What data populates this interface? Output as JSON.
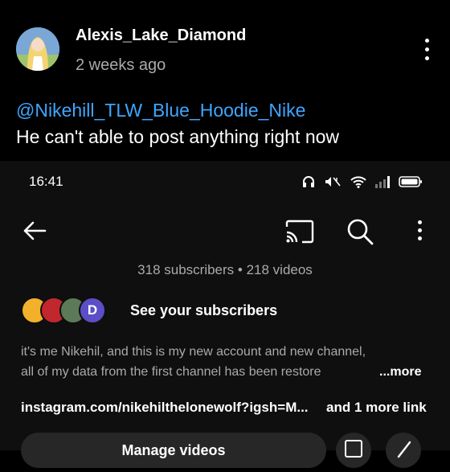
{
  "post": {
    "author": "Alexis_Lake_Diamond",
    "time": "2 weeks ago",
    "mention": "@Nikehill_TLW_Blue_Hoodie_Nike",
    "text": "He can't able to post anything right now"
  },
  "embedded_screenshot": {
    "status_bar": {
      "time": "16:41",
      "icons": [
        "headphones-icon",
        "mute-icon",
        "wifi-icon",
        "signal-icon",
        "battery-icon"
      ]
    },
    "toolbar": {
      "icons": [
        "back-arrow-icon",
        "cast-icon",
        "search-icon",
        "more-vert-icon"
      ]
    },
    "channel": {
      "stats": "318 subscribers • 218 videos",
      "subscriber_avatars": [
        {
          "letter": "",
          "color": "#f3b12b"
        },
        {
          "letter": "",
          "color": "#c1272d"
        },
        {
          "letter": "",
          "color": "#5c7a58"
        },
        {
          "letter": "D",
          "color": "#5b4ec6"
        }
      ],
      "see_subscribers": "See your subscribers",
      "description_line1": "it's me Nikehil, and this is my new account and new channel,",
      "description_line2": "all of my data from the first channel has been restore",
      "more_label": "...more",
      "link": "instagram.com/nikehilthelonewolf?igsh=M...",
      "more_link": "and 1 more link",
      "manage_videos_label": "Manage videos"
    }
  },
  "colors": {
    "background": "#000000",
    "link_blue": "#3ea6ff",
    "muted_text": "#aaaaaa",
    "button_bg": "#272727"
  }
}
